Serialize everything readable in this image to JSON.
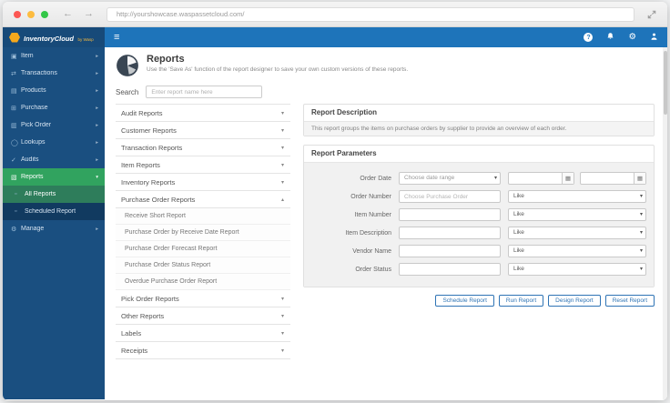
{
  "browser": {
    "url": "http://yourshowcase.waspassetcloud.com/"
  },
  "icons": {
    "back": "←",
    "forward": "→",
    "menu": "≡",
    "help": "?",
    "gear": "⚙",
    "chevron_right": "▸",
    "chevron_down": "▾",
    "chevron_up": "▴",
    "caret": "▾",
    "calendar": "▦"
  },
  "sidebar": {
    "logo_title": "InventoryCloud",
    "logo_subtitle": "by Wasp",
    "items": [
      {
        "icon": "▣",
        "label": "Item"
      },
      {
        "icon": "⇄",
        "label": "Transactions"
      },
      {
        "icon": "▤",
        "label": "Products"
      },
      {
        "icon": "⊞",
        "label": "Purchase"
      },
      {
        "icon": "▥",
        "label": "Pick Order"
      },
      {
        "icon": "◯",
        "label": "Lookups"
      },
      {
        "icon": "✓",
        "label": "Audits"
      },
      {
        "icon": "▧",
        "label": "Reports"
      },
      {
        "icon": "▫",
        "label": "All Reports"
      },
      {
        "icon": "▫",
        "label": "Scheduled Report"
      },
      {
        "icon": "⚙",
        "label": "Manage"
      }
    ]
  },
  "header": {
    "title": "Reports",
    "subtitle": "Use the 'Save As' function of the report designer to save your own custom versions of these reports."
  },
  "search": {
    "label": "Search",
    "placeholder": "Enter report name here"
  },
  "report_groups": [
    {
      "label": "Audit Reports"
    },
    {
      "label": "Customer Reports"
    },
    {
      "label": "Transaction Reports"
    },
    {
      "label": "Item Reports"
    },
    {
      "label": "Inventory Reports"
    },
    {
      "label": "Purchase Order Reports"
    },
    {
      "label": "Pick Order Reports"
    },
    {
      "label": "Other Reports"
    },
    {
      "label": "Labels"
    },
    {
      "label": "Receipts"
    }
  ],
  "purchase_order_reports": [
    "Receive Short Report",
    "Purchase Order by Receive Date Report",
    "Purchase Order Forecast Report",
    "Purchase Order Status Report",
    "Overdue Purchase Order Report"
  ],
  "description": {
    "title": "Report Description",
    "body": "This report groups the items on purchase orders by supplier to provide an overview of each order."
  },
  "parameters": {
    "title": "Report Parameters",
    "order_date": {
      "label": "Order Date",
      "select_value": "Choose date range"
    },
    "rows": [
      {
        "label": "Order Number",
        "placeholder": "Choose Purchase Order",
        "operator": "Like"
      },
      {
        "label": "Item Number",
        "placeholder": "",
        "operator": "Like"
      },
      {
        "label": "Item Description",
        "placeholder": "",
        "operator": "Like"
      },
      {
        "label": "Vendor Name",
        "placeholder": "",
        "operator": "Like"
      },
      {
        "label": "Order Status",
        "placeholder": "",
        "operator": "Like"
      }
    ],
    "buttons": [
      {
        "label": "Schedule Report"
      },
      {
        "label": "Run Report"
      },
      {
        "label": "Design Report"
      },
      {
        "label": "Reset Report"
      }
    ]
  }
}
